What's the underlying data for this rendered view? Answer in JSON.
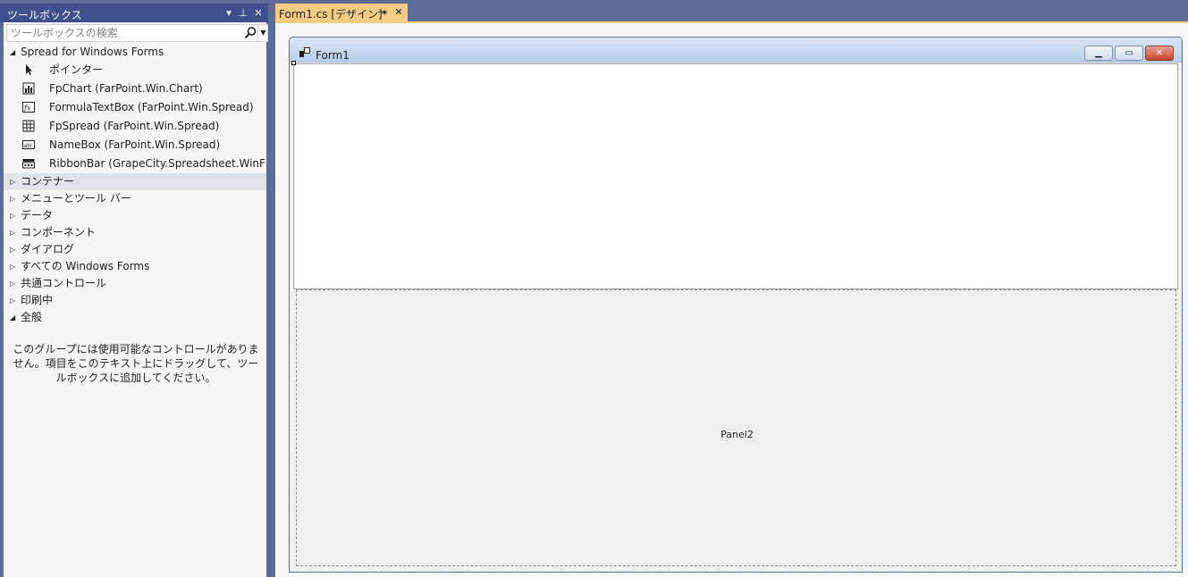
{
  "toolbox": {
    "title": "ツールボックス",
    "controls": {
      "dropdown": "▾",
      "pin": "⊥",
      "close": "✕"
    },
    "search": {
      "placeholder": "ツールボックスの検索",
      "value": ""
    },
    "group_open": {
      "arrow": "◢",
      "label": "Spread for Windows Forms"
    },
    "items": [
      {
        "icon": "pointer-icon",
        "label": "ポインター"
      },
      {
        "icon": "chart-icon",
        "label": "FpChart (FarPoint.Win.Chart)"
      },
      {
        "icon": "formula-textbox-icon",
        "label": "FormulaTextBox (FarPoint.Win.Spread)"
      },
      {
        "icon": "spread-grid-icon",
        "label": "FpSpread (FarPoint.Win.Spread)"
      },
      {
        "icon": "namebox-icon",
        "label": "NameBox (FarPoint.Win.Spread)"
      },
      {
        "icon": "ribbonbar-icon",
        "label": "RibbonBar (GrapeCity.Spreadsheet.WinForms"
      }
    ],
    "categories": [
      {
        "arrow": "▷",
        "label": "コンテナー",
        "selected": true
      },
      {
        "arrow": "▷",
        "label": "メニューとツール バー"
      },
      {
        "arrow": "▷",
        "label": "データ"
      },
      {
        "arrow": "▷",
        "label": "コンポーネント"
      },
      {
        "arrow": "▷",
        "label": "ダイアログ"
      },
      {
        "arrow": "▷",
        "label": "すべての Windows Forms"
      },
      {
        "arrow": "▷",
        "label": "共通コントロール"
      },
      {
        "arrow": "▷",
        "label": "印刷中"
      },
      {
        "arrow": "◢",
        "label": "全般"
      }
    ],
    "empty_message": "このグループには使用可能なコントロールがありません。項目をこのテキスト上にドラッグして、ツールボックスに追加してください。"
  },
  "document": {
    "tab": {
      "label": "Form1.cs [デザイン]*",
      "pin": "⊸",
      "close": "✕"
    },
    "form": {
      "title": "Form1",
      "buttons": {
        "minimize": "▁",
        "maximize": "▭",
        "close": "✕"
      },
      "panel2_label": "Panel2"
    }
  },
  "colors": {
    "frame": "#5d6b99",
    "title_active": "#40508d",
    "tab_active": "#f5cc84",
    "toolbox_bg": "#f5f5f5"
  }
}
